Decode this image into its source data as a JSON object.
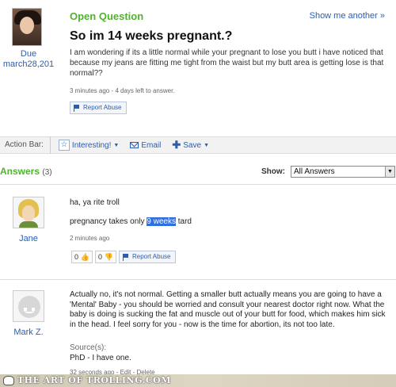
{
  "question": {
    "asker_name": "Due",
    "asker_date": "march28,201",
    "type_label": "Open Question",
    "show_more": "Show me another »",
    "title": "So im 14 weeks pregnant.?",
    "body": "I am wondering if its a little normal while your pregnant to lose you butt i have noticed that because my jeans are fitting me tight from the waist but my butt area is getting lose is that normal??",
    "meta": "3 minutes ago - 4 days left to answer.",
    "report_label": "Report Abuse"
  },
  "action_bar": {
    "label": "Action Bar:",
    "interesting_label": "Interesting!",
    "email_label": "Email",
    "save_label": "Save"
  },
  "answers_header": {
    "title": "Answers",
    "count": "(3)",
    "show_label": "Show:",
    "show_selected": "All Answers"
  },
  "answers": [
    {
      "name": "Jane",
      "line1": "ha, ya rite troll",
      "line2_before": "pregnancy takes only ",
      "line2_highlight": "9 weeks",
      "line2_after": " tard",
      "meta": "2 minutes ago",
      "thumbs_up": "0",
      "thumbs_down": "0",
      "report_label": "Report Abuse"
    },
    {
      "name": "Mark Z.",
      "body": "Actually no, it's not normal. Getting a smaller butt actually means you are going to have a 'Mental' Baby - you should be worried and consult your nearest doctor right now. What the baby is doing is sucking the fat and muscle out of your butt for food, which makes him sick in the head. I feel sorry for you - now is the time for abortion, its not too late.",
      "sources_label": "Source(s):",
      "sources": "PhD - I have one.",
      "meta": "32 seconds ago - Edit - Delete"
    }
  ],
  "footer": {
    "text": "THE ART OF TROLLING.COM"
  },
  "colors": {
    "accent_green": "#4fb32d",
    "link_blue": "#2a5db0",
    "highlight": "#2f6fe0"
  }
}
